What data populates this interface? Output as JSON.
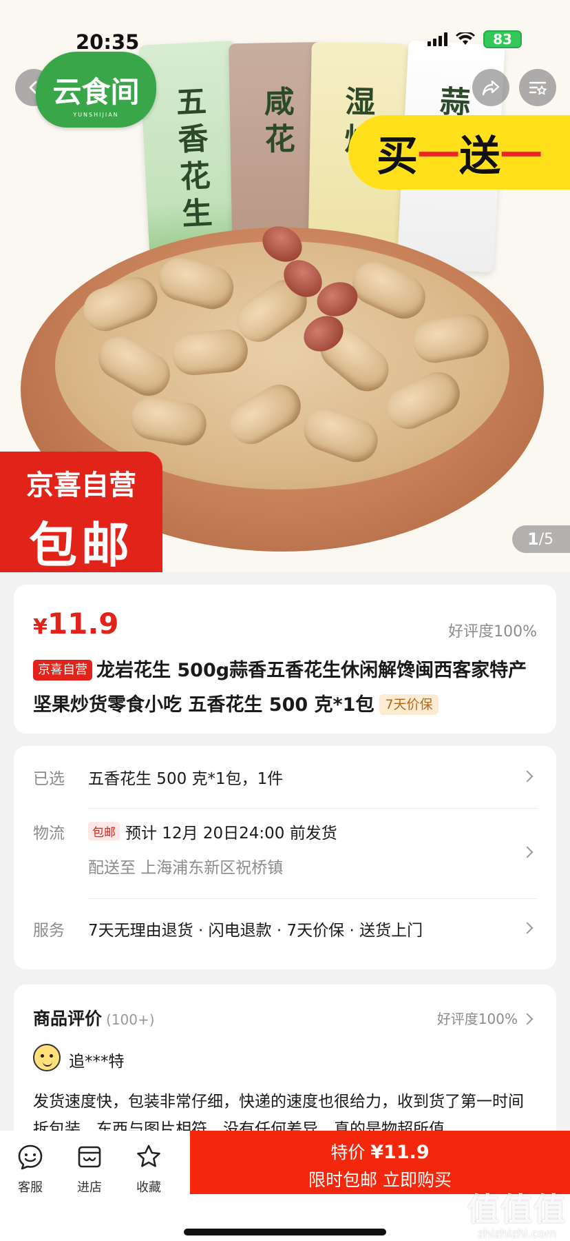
{
  "status_bar": {
    "time": "20:35",
    "battery": "83"
  },
  "hero": {
    "brand_logo_text": "云食间",
    "brand_logo_sub": "YUNSHIJIAN",
    "bag_labels": [
      "五香花生",
      "咸花",
      "湿炒",
      "蒜"
    ],
    "promo": {
      "buy": "买",
      "dash1": "一",
      "gift": "送",
      "dash2": "一"
    },
    "self_badge": {
      "line1": "京喜自营",
      "line2": "包邮"
    },
    "image_counter": {
      "current": "1",
      "total": "/5"
    }
  },
  "product": {
    "price_symbol": "¥",
    "price": "11.9",
    "good_rate": "好评度100%",
    "title_tag": "京喜自营",
    "title": "龙岩花生 500g蒜香五香花生休闲解馋闽西客家特产坚果炒货零食小吃 五香花生 500 克*1包",
    "price_protect_tag": "7天价保"
  },
  "spec": {
    "selected_label": "已选",
    "selected_value": "五香花生 500 克*1包，1件",
    "logistics_label": "物流",
    "logistics_tag": "包邮",
    "logistics_value": "预计 12月 20日24:00 前发货",
    "logistics_sub": "配送至 上海浦东新区祝桥镇",
    "service_label": "服务",
    "service_value": "7天无理由退货 · 闪电退款 · 7天价保 · 送货上门"
  },
  "reviews": {
    "title": "商品评价",
    "count": "(100+)",
    "rate": "好评度100%",
    "reviewer": "追***特",
    "text": "发货速度快，包装非常仔细，快递的速度也很给力，收到货了第一时间拆包装，东西与图片相符，没有任何差异，真的是物超所值，"
  },
  "bottom_bar": {
    "service": "客服",
    "store": "进店",
    "favorite": "收藏",
    "buy_line1_prefix": "特价",
    "buy_line1_price": "¥11.9",
    "buy_line2": "限时包邮 立即购买"
  },
  "watermark": {
    "big": "值值值",
    "small": "zhizhizhi.com"
  },
  "colors": {
    "accent_red": "#e2231a",
    "buy_red": "#f2270c",
    "promo_yellow": "#ffe01a",
    "brand_green": "#3aa64a"
  }
}
